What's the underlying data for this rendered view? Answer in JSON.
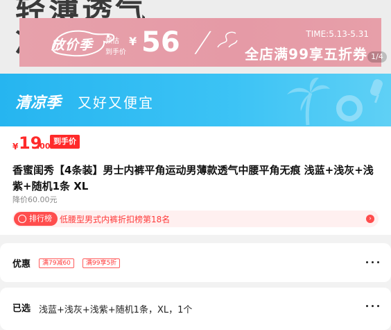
{
  "hero": {
    "big_text_line1": "轻薄透气",
    "big_text_line2": "冰"
  },
  "promo": {
    "logo_text": "放价季",
    "estimate_label": "预估",
    "arrival_label": "到手价",
    "currency": "¥",
    "price": "56",
    "time": "TIME:5.13-5.31",
    "sale_text": "全店满99享五折券"
  },
  "page_indicator": "1/4",
  "banner": {
    "brand": "清凉季",
    "slogan": "又好又便宜"
  },
  "product": {
    "currency": "¥",
    "price_int": "19",
    "price_dec": ".00",
    "price_tag": "到手价",
    "title": "香蜜闺秀【4条装】男士内裤平角运动男薄款透气中腰平角无痕 浅蓝+浅灰+浅紫+随机1条 XL",
    "orig_price": "降价60.00元",
    "rank_badge": "排行榜",
    "rank_text": "低腰型男式内裤折扣榜第18名",
    "rank_arrow": "›"
  },
  "discounts": {
    "label": "优惠",
    "coupons": [
      "满79减60",
      "满99享5折"
    ]
  },
  "selection": {
    "label": "已选",
    "value": "浅蓝+浅灰+浅紫+随机1条，XL，1个"
  },
  "colors": {
    "price_red": "#ff2a2a",
    "banner_blue": "#26b5f0",
    "promo_pink": "#e59aa6"
  }
}
